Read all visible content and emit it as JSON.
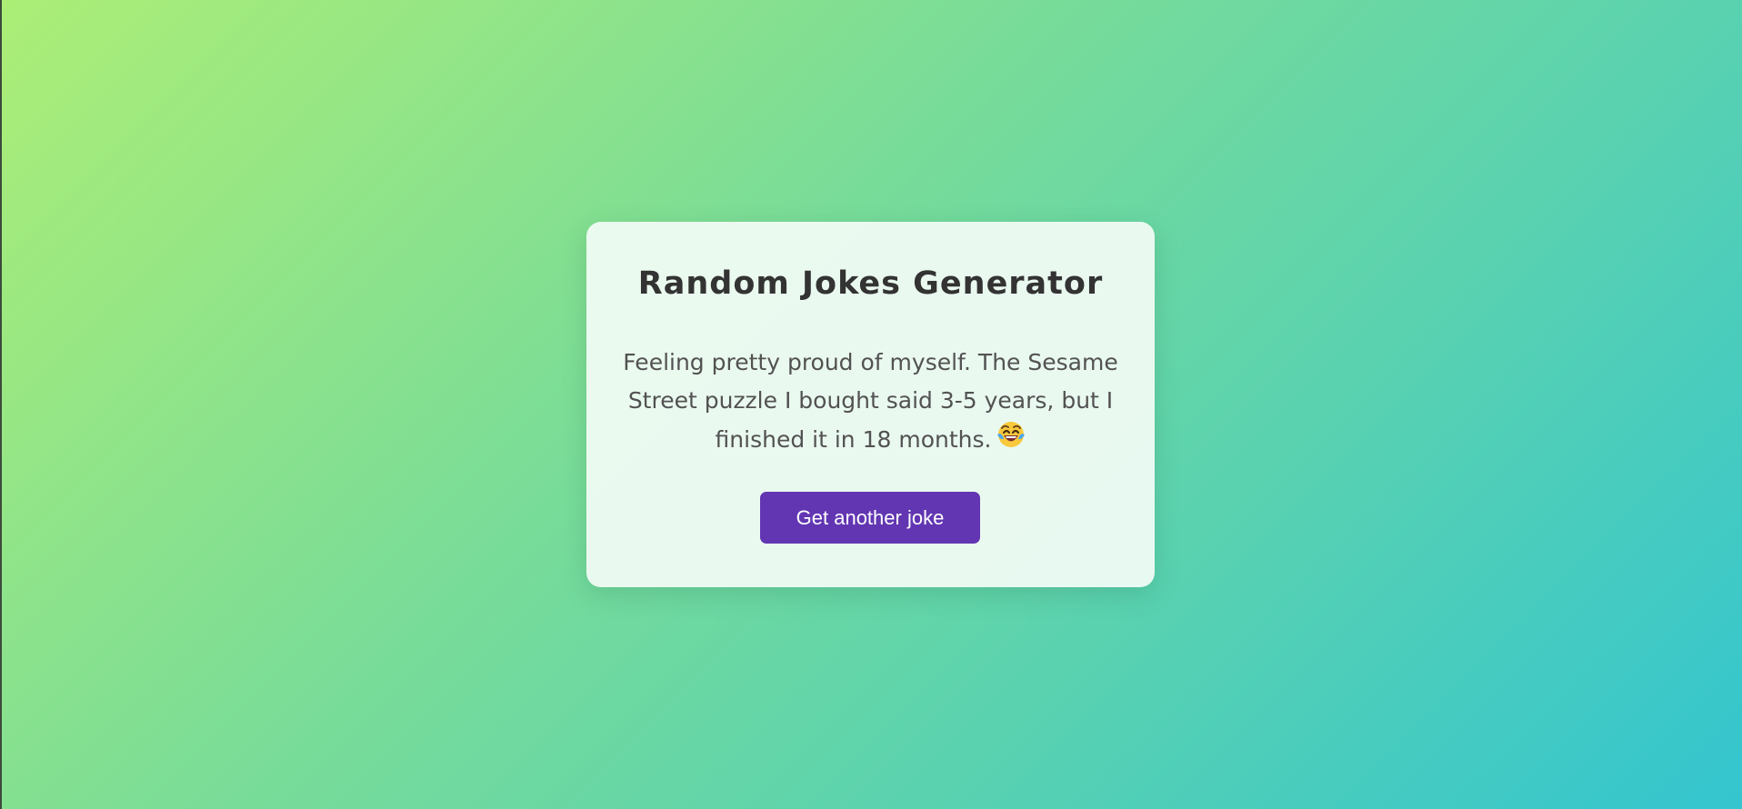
{
  "card": {
    "title": "Random Jokes Generator",
    "joke": "Feeling pretty proud of myself. The Sesame Street puzzle I bought said 3-5 years, but I finished it in 18 months.",
    "joke_emoji_icon": "face-with-tears-of-joy-icon",
    "button_label": "Get another joke"
  },
  "colors": {
    "background_start": "#acee76",
    "background_end": "#34c5cf",
    "card_background": "#f4fcf6",
    "title": "#333333",
    "joke_text": "#525252",
    "button": "#6236b2",
    "button_text": "#ffffff"
  }
}
